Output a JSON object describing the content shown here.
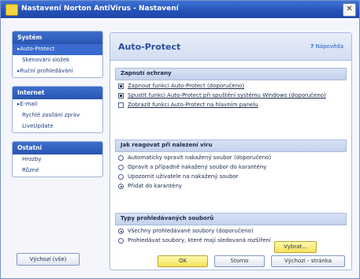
{
  "window": {
    "title": "Nastavení Norton AntiVirus - Nastavení"
  },
  "sidebar": {
    "panels": [
      {
        "heading": "Systém",
        "items": [
          {
            "label": "Auto-Protect",
            "selected": true,
            "bullet": true
          },
          {
            "label": "Skenování složek",
            "selected": false,
            "bullet": false
          },
          {
            "label": "Ruční prohledávání",
            "selected": false,
            "bullet": true
          }
        ]
      },
      {
        "heading": "Internet",
        "items": [
          {
            "label": "E-mail",
            "selected": false,
            "bullet": true
          },
          {
            "label": "Rychlé zasílání zpráv",
            "selected": false,
            "bullet": false
          },
          {
            "label": "LiveUpdate",
            "selected": false,
            "bullet": false
          }
        ]
      },
      {
        "heading": "Ostatní",
        "items": [
          {
            "label": "Hrozby",
            "selected": false,
            "bullet": false
          },
          {
            "label": "Různé",
            "selected": false,
            "bullet": false
          }
        ]
      }
    ],
    "defaults_button": "Výchozí (vše)"
  },
  "main": {
    "title": "Auto-Protect",
    "help_link": "Nápověda",
    "group1": {
      "heading": "Zapnutí ochrany",
      "options": [
        {
          "text": "Zapnout funkci Auto-Protect (doporučeno)",
          "checked": true,
          "underline": true
        },
        {
          "text": "Spustit funkci Auto-Protect při spuštění systému Windows (doporučeno)",
          "checked": true,
          "underline": true
        },
        {
          "text": "Zobrazit funkci Auto-Protect na hlavním panelu",
          "checked": false,
          "underline": true
        }
      ]
    },
    "group2": {
      "heading": "Jak reagovat při nalezení viru",
      "options": [
        {
          "text": "Automaticky opravit nakažený soubor (doporučeno)",
          "checked": false
        },
        {
          "text": "Opravit a případně nakažený soubor do karantény",
          "checked": false
        },
        {
          "text": "Upozornit uživatele na nakažený soubor",
          "checked": false
        },
        {
          "text": "Přidat do karantény",
          "checked": true
        }
      ]
    },
    "group3": {
      "heading": "Typy prohledávaných souborů",
      "options": [
        {
          "text": "Všechny prohledávané soubory (doporučeno)",
          "checked": true
        },
        {
          "text": "Prohledávat soubory, které mají sledovaná rozšíření",
          "checked": false
        }
      ],
      "select_button": "Vybrat..."
    },
    "buttons": {
      "ok": "OK",
      "cancel": "Storno",
      "default": "Výchozí - stránka"
    }
  }
}
